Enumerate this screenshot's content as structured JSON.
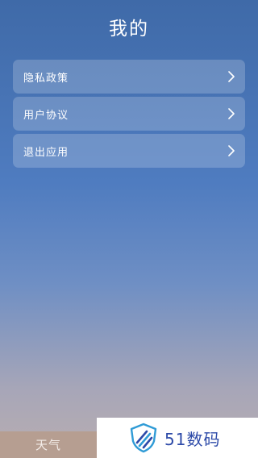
{
  "header": {
    "title": "我的"
  },
  "menu": {
    "items": [
      {
        "label": "隐私政策",
        "icon": "chevron-right-icon"
      },
      {
        "label": "用户协议",
        "icon": "chevron-right-icon"
      },
      {
        "label": "退出应用",
        "icon": "chevron-right-icon"
      }
    ]
  },
  "bottom_nav": {
    "weather_label": "天气"
  },
  "watermark": {
    "text": "51数码",
    "icon": "shield-logo-icon"
  },
  "colors": {
    "gradient_top": "#3f6aa8",
    "gradient_bottom": "#b9aeb0",
    "weather_tab": "#b69e91",
    "watermark_text": "#2d4aa8"
  }
}
